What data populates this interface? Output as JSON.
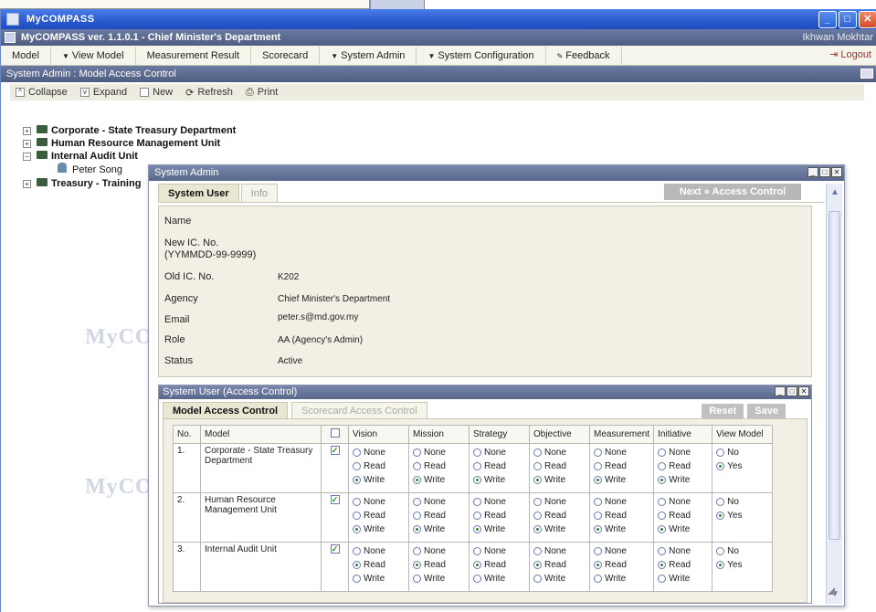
{
  "window": {
    "title": "MyCOMPASS",
    "app_title": "MyCOMPASS ver. 1.1.0.1 - Chief Minister's Department",
    "user": "Ikhwan Mokhtar",
    "btn_min": "_",
    "btn_max": "□",
    "btn_close": "✕"
  },
  "menu": {
    "items": [
      "Model",
      "View Model",
      "Measurement Result",
      "Scorecard",
      "System Admin",
      "System Configuration",
      "Feedback"
    ],
    "logout": "Logout"
  },
  "section": {
    "title": "System Admin : Model Access Control"
  },
  "toolbar": {
    "collapse": "Collapse",
    "expand": "Expand",
    "new": "New",
    "refresh": "Refresh",
    "print": "Print"
  },
  "tree": {
    "corporate": "Corporate - State Treasury Department",
    "hr": "Human Resource Management Unit",
    "internal_audit": "Internal Audit Unit",
    "peter": "Peter Song",
    "treasury": "Treasury - Training"
  },
  "watermark": "MyCO",
  "dialog": {
    "title": "System Admin",
    "tab_system_user": "System User",
    "tab_info": "Info",
    "next": "Next » Access Control",
    "fields": {
      "name_label": "Name",
      "name_value": "",
      "new_ic_label_1": "New IC. No.",
      "new_ic_label_2": "(YYMMDD-99-9999)",
      "old_ic_label": "Old IC. No.",
      "old_ic_value": "K202",
      "agency_label": "Agency",
      "agency_value": "Chief Minister's Department",
      "email_label": "Email",
      "email_value": "peter.s@md.gov.my",
      "role_label": "Role",
      "role_value": "AA (Agency's Admin)",
      "status_label": "Status",
      "status_value": "Active"
    }
  },
  "access": {
    "title": "System User (Access Control)",
    "tab_model": "Model Access Control",
    "tab_scorecard": "Scorecard Access Control",
    "reset": "Reset",
    "save": "Save",
    "headers": [
      "No.",
      "Model",
      "",
      "Vision",
      "Mission",
      "Strategy",
      "Objective",
      "Measurement",
      "Initiative",
      "View Model"
    ],
    "opt_none": "None",
    "opt_read": "Read",
    "opt_write": "Write",
    "opt_no": "No",
    "opt_yes": "Yes",
    "rows": [
      {
        "no": "1.",
        "model": "Corporate - State Treasury Department",
        "checked": true,
        "level": "write",
        "view": "yes"
      },
      {
        "no": "2.",
        "model": "Human Resource Management Unit",
        "checked": true,
        "level": "write",
        "view": "yes"
      },
      {
        "no": "3.",
        "model": "Internal Audit Unit",
        "checked": true,
        "level": "read",
        "view": "yes"
      }
    ]
  }
}
